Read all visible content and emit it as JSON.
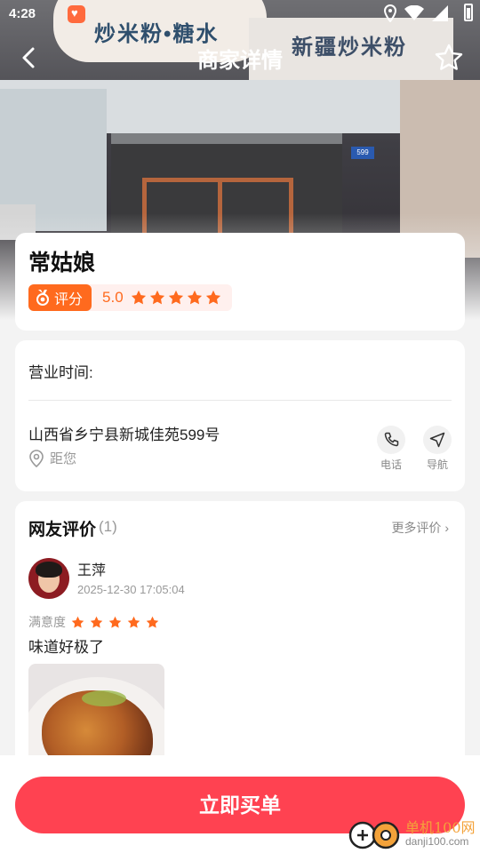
{
  "status_bar": {
    "time": "4:28"
  },
  "hero": {
    "sign_text": "炒米粉•糖水",
    "banner_text": "新疆炒米粉",
    "plate_number": "599"
  },
  "nav": {
    "title": "商家详情"
  },
  "shop": {
    "name": "常姑娘",
    "rating_tag": "评分",
    "score": "5.0",
    "stars": 5
  },
  "info": {
    "hours_label": "营业时间:",
    "address": "山西省乡宁县新城佳苑599号",
    "distance_label": "距您",
    "phone_label": "电话",
    "navigate_label": "导航"
  },
  "reviews": {
    "title": "网友评价",
    "count": "(1)",
    "more": "更多评价",
    "items": [
      {
        "name": "王萍",
        "date": "2025-12-30 17:05:04",
        "satisfaction_label": "满意度",
        "stars": 5,
        "text": "味道好极了"
      }
    ]
  },
  "footer": {
    "buy_label": "立即买单"
  },
  "watermark": {
    "cn": "单机100网",
    "en": "danji100.com"
  },
  "colors": {
    "accent": "#ff4251",
    "rating_orange": "#ff6a1e"
  }
}
